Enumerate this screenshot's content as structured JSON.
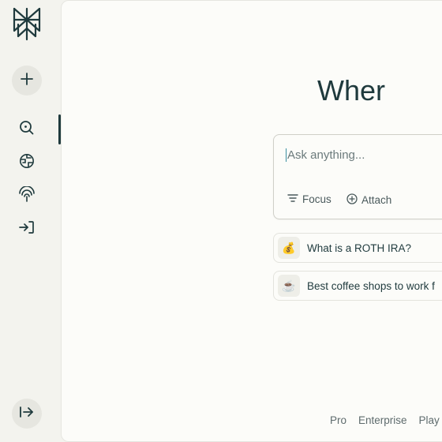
{
  "nav": {
    "new_label": "",
    "items": [
      {
        "name": "discover",
        "icon": "search-icon",
        "active": true
      },
      {
        "name": "spaces",
        "icon": "globe-icon",
        "active": false
      },
      {
        "name": "library",
        "icon": "signal-icon",
        "active": false
      },
      {
        "name": "signin",
        "icon": "sign-in-icon",
        "active": false
      }
    ]
  },
  "main": {
    "headline": "Wher",
    "search": {
      "placeholder": "Ask anything...",
      "value": "",
      "focus_label": "Focus",
      "attach_label": "Attach"
    },
    "suggestions": [
      {
        "emoji": "💰",
        "text": "What is a ROTH IRA?"
      },
      {
        "emoji": "☕",
        "text": "Best coffee shops to work f"
      }
    ]
  },
  "footer": {
    "links": [
      "Pro",
      "Enterprise",
      "Play"
    ]
  },
  "colors": {
    "accent": "#1f3a3d",
    "sidebar_bg": "#f3f3ee",
    "main_bg": "#fcfcf9",
    "caret": "#3a8fa0"
  }
}
